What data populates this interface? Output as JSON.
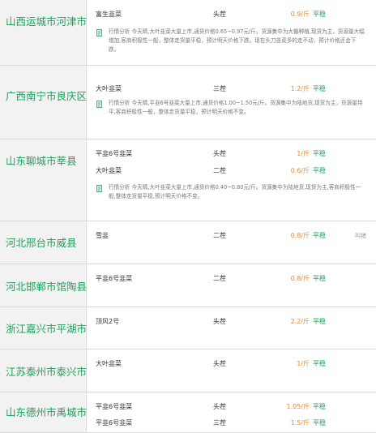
{
  "accent_green": "#1aa35e",
  "price_orange": "#f08a2c",
  "rows": [
    {
      "region": "山西运城市河津市",
      "items": [
        {
          "variety": "富生韭菜",
          "grade": "头茬",
          "price": "0.9/斤",
          "trend": "平稳",
          "side": ""
        }
      ],
      "note": "行情分析 今天晴,大叶韭菜大量上市,通货价格0.65~0.97元/斤。货源集中为大棚种植,现货为主，货源量大幅增加,客商积极性一般，整体走货量平稳，预计明天价格下跌。现在头刀韭菜多的走不动，预计价格还会下跌。"
    },
    {
      "region": "广西南宁市良庆区",
      "items": [
        {
          "variety": "大叶韭菜",
          "grade": "三茬",
          "price": "1.2/斤",
          "trend": "平稳",
          "side": ""
        }
      ],
      "note": "行情分析 今天晴,平韭6号韭菜大量上市,通货价格1.00~1.50元/斤。货源集中为陆地货,现货为主，货源量持平,客商积极性一般，整体走货量平稳，预计明天价格不变。"
    },
    {
      "region": "山东聊城市莘县",
      "items": [
        {
          "variety": "平韭6号韭菜",
          "grade": "头茬",
          "price": "1/斤",
          "trend": "平稳",
          "side": ""
        },
        {
          "variety": "大叶韭菜",
          "grade": "二茬",
          "price": "0.6/斤",
          "trend": "平稳",
          "side": ""
        }
      ],
      "note": "行情分析 今天晴,大叶韭菜大量上市,通货价格0.40~0.80元/斤。货源集中为陆地货,现货为主,客商积极性一般,整体走货量平稳,预计明天价格不变。"
    },
    {
      "region": "河北邢台市威县",
      "items": [
        {
          "variety": "雪韭",
          "grade": "二茬",
          "price": "0.8/斤",
          "trend": "平稳",
          "side": "叫猪"
        }
      ],
      "note": ""
    },
    {
      "region": "河北邯郸市馆陶县",
      "items": [
        {
          "variety": "平韭6号韭菜",
          "grade": "二茬",
          "price": "0.8/斤",
          "trend": "平稳",
          "side": ""
        }
      ],
      "note": ""
    },
    {
      "region": "浙江嘉兴市平湖市",
      "items": [
        {
          "variety": "顶风2号",
          "grade": "头茬",
          "price": "2.2/斤",
          "trend": "平稳",
          "side": ""
        }
      ],
      "note": ""
    },
    {
      "region": "江苏泰州市泰兴市",
      "items": [
        {
          "variety": "大叶韭菜",
          "grade": "头茬",
          "price": "1/斤",
          "trend": "平稳",
          "side": ""
        }
      ],
      "note": ""
    },
    {
      "region": "山东德州市禹城市",
      "items": [
        {
          "variety": "平韭6号韭菜",
          "grade": "头茬",
          "price": "1.05/斤",
          "trend": "平稳",
          "side": ""
        },
        {
          "variety": "平韭6号韭菜",
          "grade": "三茬",
          "price": "1.5/斤",
          "trend": "平稳",
          "side": ""
        }
      ],
      "note": ""
    }
  ]
}
